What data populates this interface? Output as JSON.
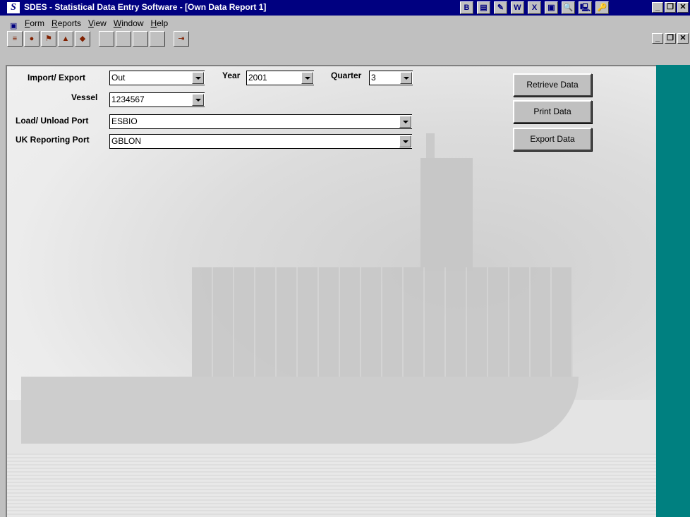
{
  "titlebar": {
    "title": "SDES - Statistical Data Entry Software - [Own Data Report 1]",
    "app_icon_glyph": "S",
    "icons": [
      "B",
      "▤",
      "✎",
      "W",
      "X",
      "▣",
      "🔍",
      "🖳",
      "🔑"
    ],
    "minimize": "_",
    "maximize": "❐",
    "close": "✕"
  },
  "menubar": {
    "items": [
      "Form",
      "Reports",
      "View",
      "Window",
      "Help"
    ]
  },
  "toolbar": {
    "tools": [
      "≡",
      "●",
      "⚑",
      "▲",
      "◆",
      "",
      "",
      "",
      ""
    ],
    "exit": "⇥"
  },
  "form": {
    "import_export": {
      "label": "Import/ Export",
      "value": "Out"
    },
    "year": {
      "label": "Year",
      "value": "2001"
    },
    "quarter": {
      "label": "Quarter",
      "value": "3"
    },
    "vessel": {
      "label": "Vessel",
      "value": "1234567"
    },
    "load_port": {
      "label": "Load/ Unload Port",
      "value": "ESBIO"
    },
    "uk_port": {
      "label": "UK Reporting Port",
      "value": "GBLON"
    }
  },
  "buttons": {
    "retrieve": "Retrieve Data",
    "print": "Print Data",
    "export": "Export Data"
  },
  "colors": {
    "title_bg": "#000080",
    "side_panel": "#008080",
    "face": "#c0c0c0"
  }
}
